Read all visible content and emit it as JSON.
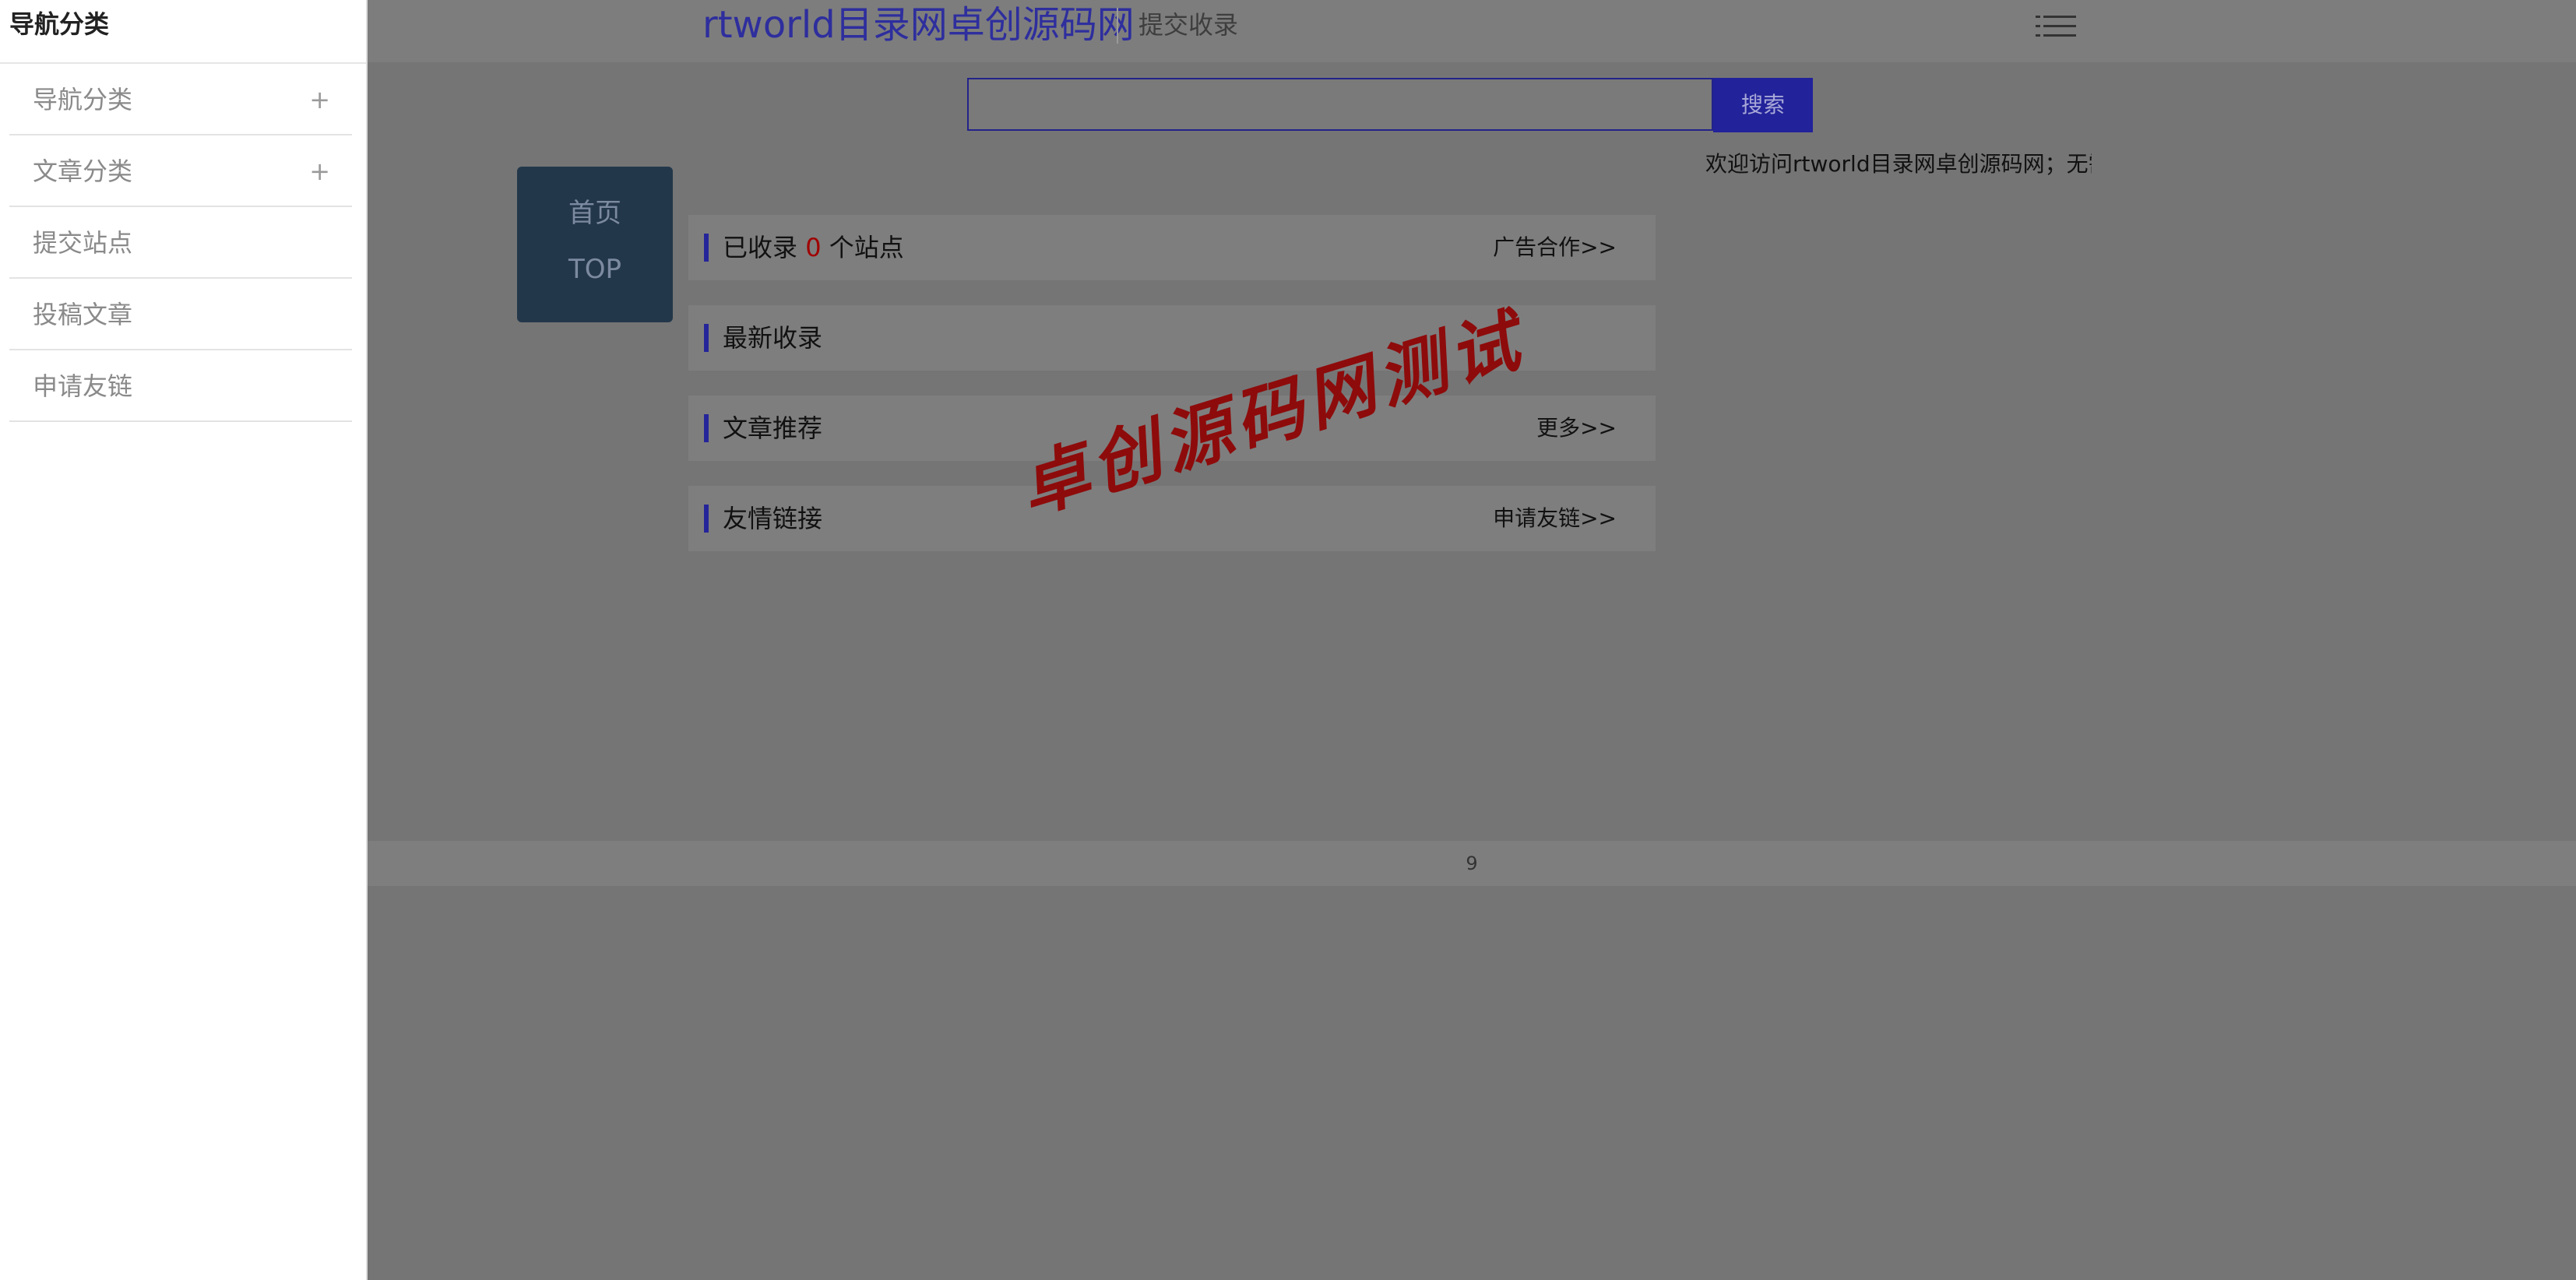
{
  "drawer": {
    "title": "导航分类",
    "items": [
      {
        "label": "导航分类",
        "expand": "+"
      },
      {
        "label": "文章分类",
        "expand": "+"
      },
      {
        "label": "提交站点"
      },
      {
        "label": "投稿文章"
      },
      {
        "label": "申请友链"
      }
    ]
  },
  "header": {
    "logo": "rtworld目录网卓创源码网",
    "submit_link": "提交收录",
    "menu_icon": "hamburger-menu-icon"
  },
  "search": {
    "placeholder": "",
    "button_label": "搜索"
  },
  "side_nav": {
    "home": "首页",
    "top": "TOP"
  },
  "panels": {
    "collected": {
      "prefix": "已收录 ",
      "count": "0",
      "suffix": " 个站点",
      "right": "广告合作>>"
    },
    "latest": {
      "title": "最新收录"
    },
    "articles": {
      "title": "文章推荐",
      "right": "更多>>"
    },
    "links": {
      "title": "友情链接",
      "right": "申请友链>>"
    }
  },
  "welcome": "欢迎访问rtworld目录网卓创源码网；无需",
  "watermark": "卓创源码网测试",
  "footer": {
    "text": "9"
  },
  "colors": {
    "accent": "#2e2e9e",
    "count": "#a00000",
    "watermark": "#8e0b0b",
    "side_nav_bg": "#23374a"
  }
}
